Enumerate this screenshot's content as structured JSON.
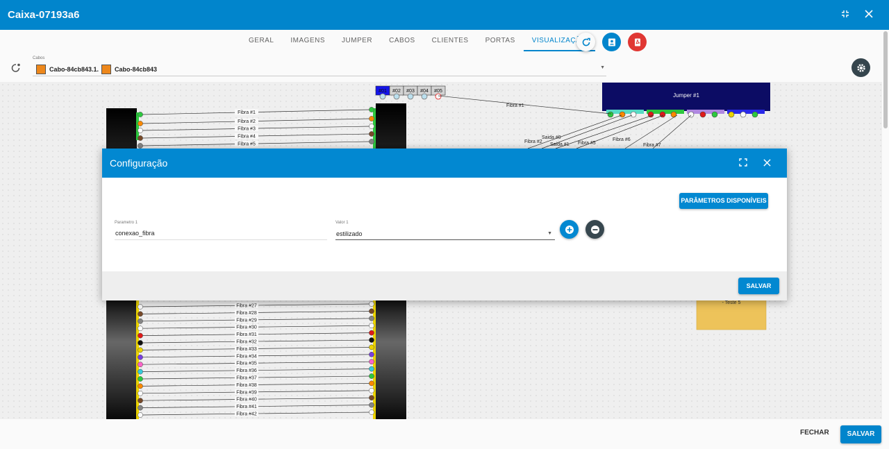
{
  "window": {
    "title": "Caixa-07193a6"
  },
  "tabs": [
    "GERAL",
    "IMAGENS",
    "JUMPER",
    "CABOS",
    "CLIENTES",
    "PORTAS",
    "VISUALIZAÇÃO"
  ],
  "active_tab": "VISUALIZAÇÃO",
  "cabos": {
    "label": "Cabos",
    "chips": [
      "Cabo-84cb843.1.",
      "Cabo-84cb843"
    ],
    "chip_color": "#f28a1c"
  },
  "diagram": {
    "top_ports": [
      "#01",
      "#02",
      "#03",
      "#04",
      "#05"
    ],
    "jumper": {
      "label": "Jumper #1"
    },
    "left_fibers_top": [
      "Fibra #1",
      "Fibra #2",
      "Fibra #3",
      "Fibra #4",
      "Fibra #5"
    ],
    "left_fibers_bottom": [
      "Fibra #27",
      "Fibra #28",
      "Fibra #29",
      "Fibra #30",
      "Fibra #31",
      "Fibra #32",
      "Fibra #33",
      "Fibra #34",
      "Fibra #35",
      "Fibra #36",
      "Fibra #37",
      "Fibra #38",
      "Fibra #39",
      "Fibra #40",
      "Fibra #41",
      "Fibra #42"
    ],
    "right_labels": [
      "Fibra #1",
      "Saida #0",
      "Fibra #2",
      "Saida #1",
      "Fibra #5",
      "Fibra #6",
      "Fibra #7"
    ],
    "note": "- Teste 5",
    "colors": {
      "canvas_bg": "#f4f4f4",
      "block": "#111111",
      "jumper": "#0d0d66",
      "note": "#f2c75c"
    }
  },
  "modal": {
    "title": "Configuração",
    "params_button": "PARÂMETROS DISPONÍVEIS",
    "param_label": "Parametro 1",
    "param_value": "conexao_fibra",
    "value_label": "Valor 1",
    "value_value": "estilizado",
    "save": "SALVAR"
  },
  "footer": {
    "close": "FECHAR",
    "save": "SALVAR"
  },
  "theme": {
    "primary": "#0288d1",
    "pdf_red": "#e53935",
    "dark": "#37474f"
  }
}
